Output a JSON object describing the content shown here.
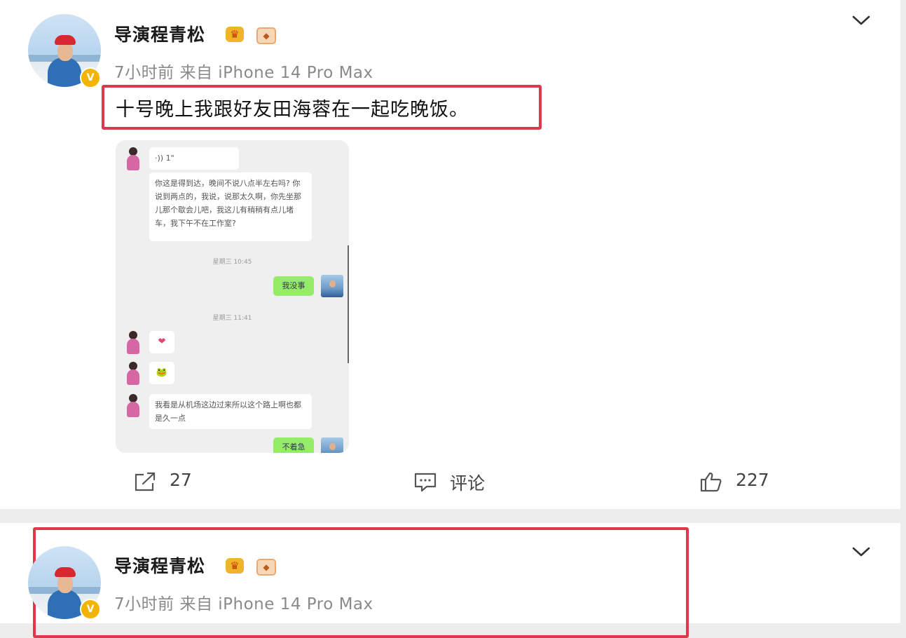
{
  "posts": [
    {
      "username": "导演程青松",
      "verified_badge": "V",
      "badge_icons": [
        "crown-badge-icon",
        "member-badge-icon"
      ],
      "time": "7小时前",
      "source": "来自 iPhone 14 Pro Max",
      "text": "十号晚上我跟好友田海蓉在一起吃晚饭。",
      "image": {
        "type": "chat-screenshot",
        "messages": [
          {
            "side": "left",
            "text": "·)) 1\""
          },
          {
            "side": "left",
            "text": "你这是得到达，晚间不说八点半左右吗? 你说到两点的，我说，说那太久啊，你先坐那儿那个歇会儿吧，我这儿有稍稍有点儿堵车，我下午不在工作室?"
          },
          {
            "side": "time",
            "text": "星期三 10:45"
          },
          {
            "side": "right",
            "text": "我没事"
          },
          {
            "side": "time",
            "text": "星期三 11:41"
          },
          {
            "side": "left",
            "text": "❤"
          },
          {
            "side": "left",
            "text": "🐸"
          },
          {
            "side": "left",
            "text": "我看是从机场这边过来所以这个路上啊也都是久一点"
          },
          {
            "side": "right",
            "text": "不着急"
          }
        ]
      },
      "actions": {
        "repost_count": "27",
        "comment_label": "评论",
        "like_count": "227"
      }
    },
    {
      "username": "导演程青松",
      "verified_badge": "V",
      "badge_icons": [
        "crown-badge-icon",
        "member-badge-icon"
      ],
      "time": "7小时前",
      "source": "来自 iPhone 14 Pro Max"
    }
  ],
  "colors": {
    "highlight_frame": "#e0384b",
    "chat_green": "#95ec69",
    "verified": "#f3b400",
    "meta_text": "#8a8a8a"
  }
}
